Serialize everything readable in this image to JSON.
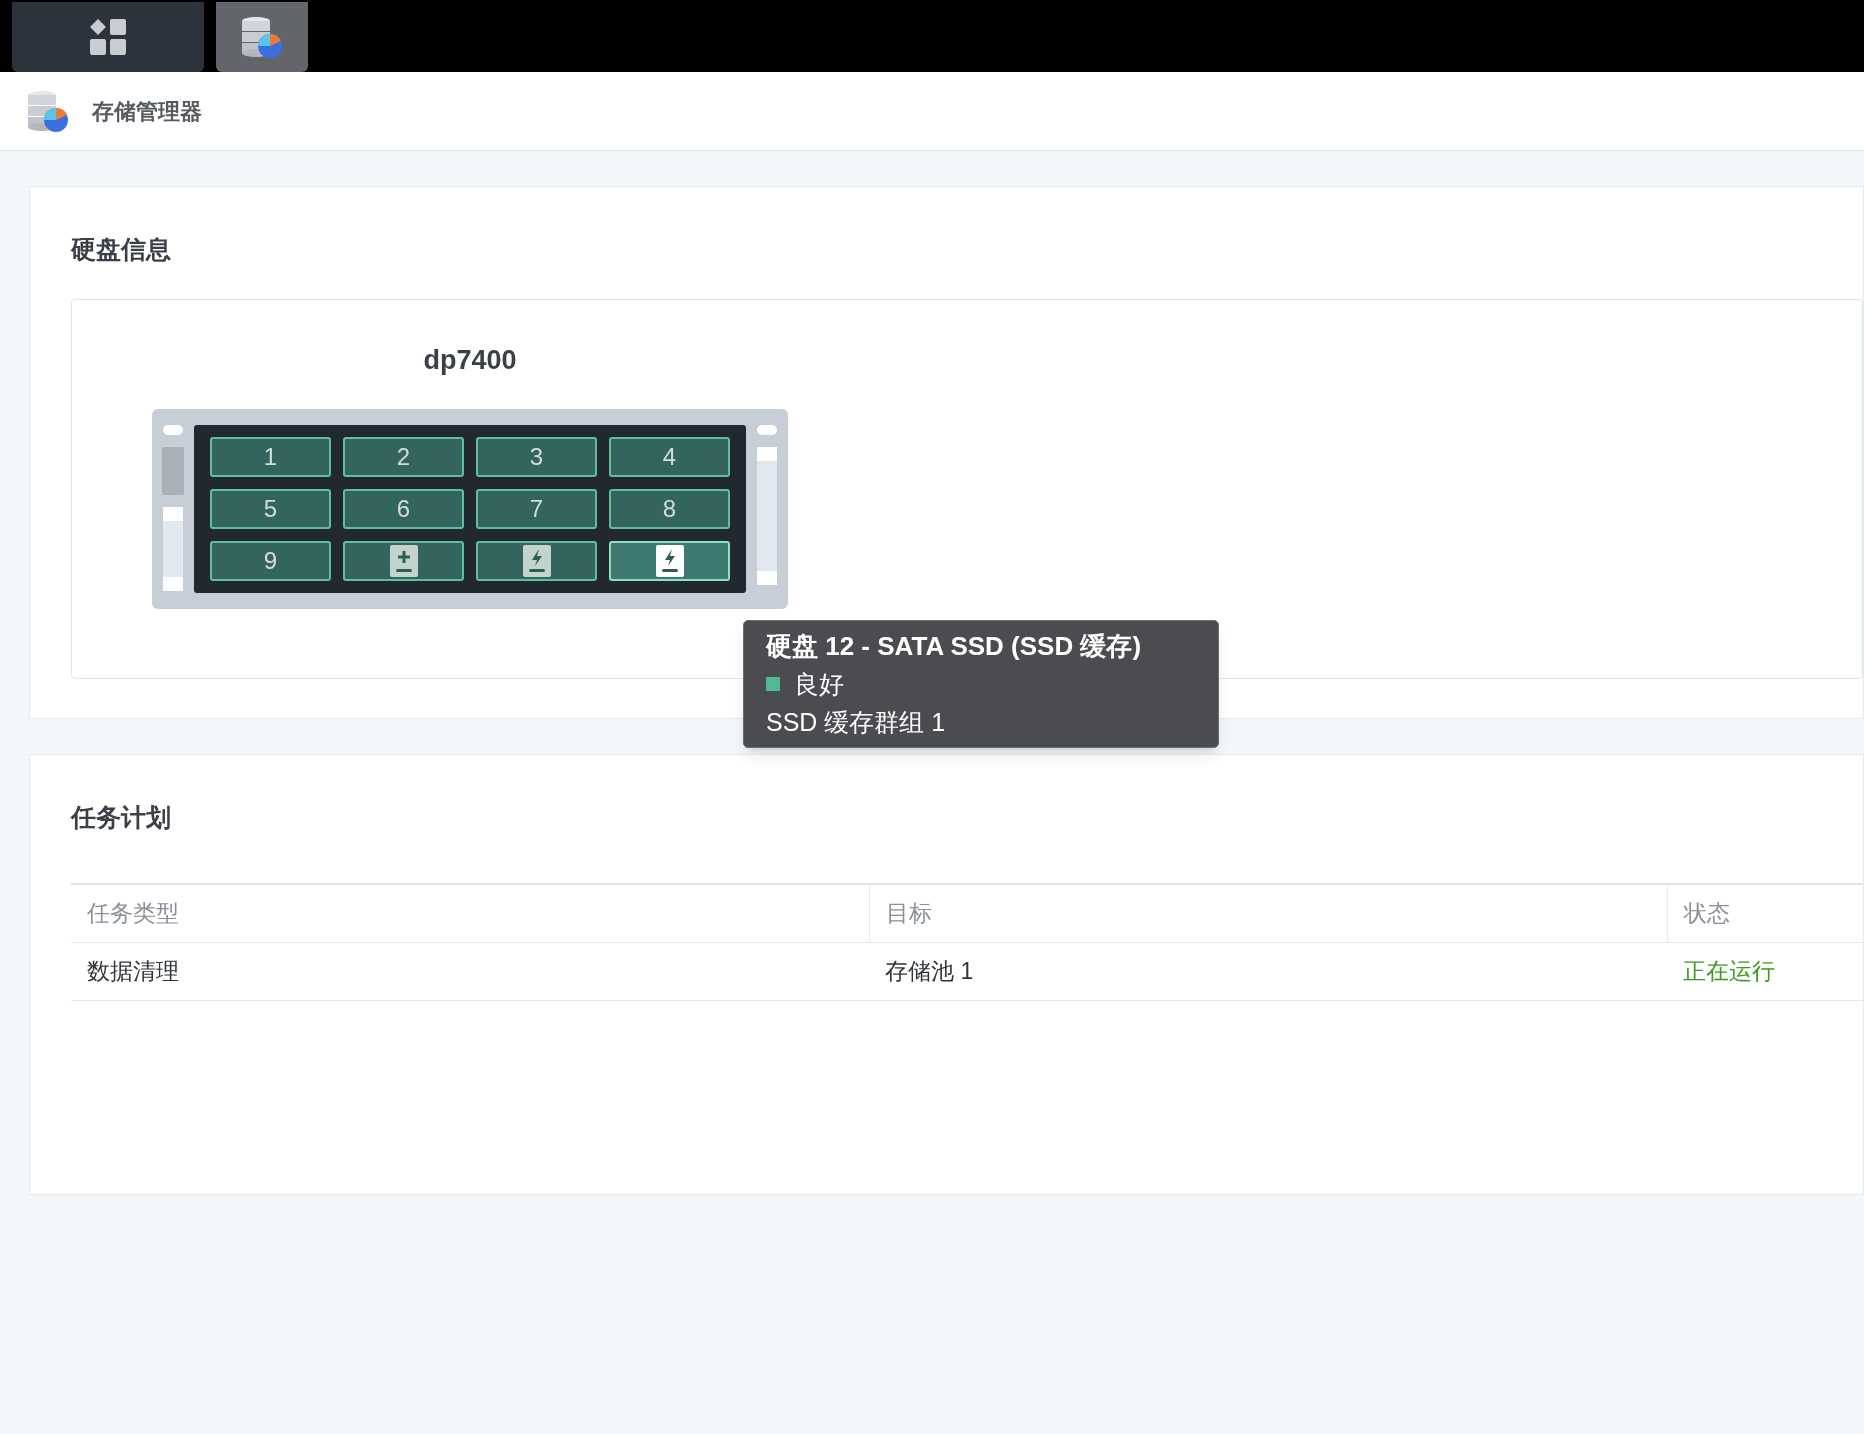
{
  "taskbar": {
    "items": [
      {
        "kind": "apps",
        "selected": false
      },
      {
        "kind": "storage",
        "selected": true
      }
    ]
  },
  "header": {
    "title": "存储管理器"
  },
  "disk_info": {
    "title": "硬盘信息",
    "device": "dp7400",
    "slots": [
      {
        "kind": "number",
        "label": "1",
        "selected": false
      },
      {
        "kind": "number",
        "label": "2",
        "selected": false
      },
      {
        "kind": "number",
        "label": "3",
        "selected": false
      },
      {
        "kind": "number",
        "label": "4",
        "selected": false
      },
      {
        "kind": "number",
        "label": "5",
        "selected": false
      },
      {
        "kind": "number",
        "label": "6",
        "selected": false
      },
      {
        "kind": "number",
        "label": "7",
        "selected": false
      },
      {
        "kind": "number",
        "label": "8",
        "selected": false
      },
      {
        "kind": "number",
        "label": "9",
        "selected": false
      },
      {
        "kind": "plus",
        "selected": false
      },
      {
        "kind": "bolt",
        "selected": false
      },
      {
        "kind": "bolt",
        "selected": true
      }
    ],
    "tooltip": {
      "title": "硬盘 12 - SATA SSD (SSD 缓存)",
      "status": "良好",
      "group": "SSD 缓存群组 1"
    }
  },
  "tasks": {
    "title": "任务计划",
    "columns": [
      "任务类型",
      "目标",
      "状态"
    ],
    "rows": [
      {
        "task_type": "数据清理",
        "target": "存储池 1",
        "status": "正在运行"
      }
    ]
  }
}
